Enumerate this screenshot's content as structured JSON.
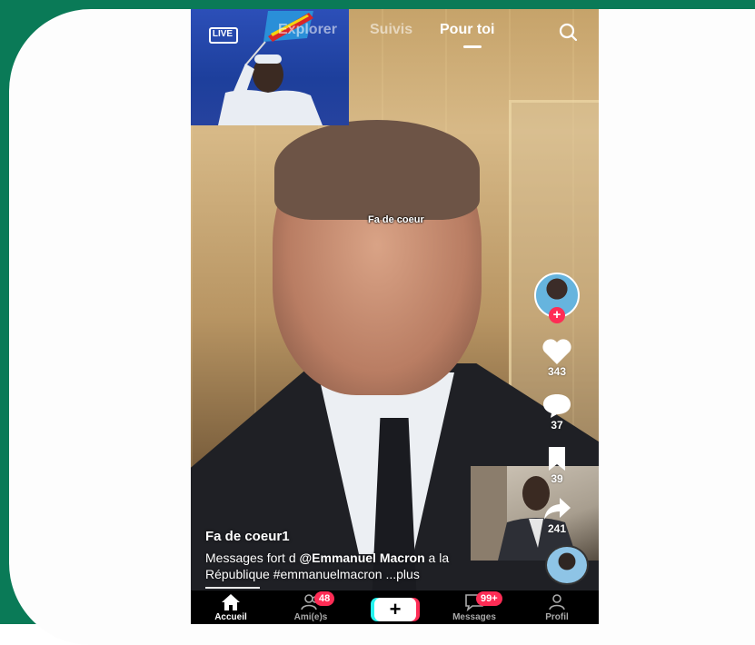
{
  "nav": {
    "live_label": "LIVE",
    "tabs": [
      {
        "label": "Explorer",
        "active": false
      },
      {
        "label": "Suivis",
        "active": false
      },
      {
        "label": "Pour toi",
        "active": true
      }
    ]
  },
  "video": {
    "overlay_text": "Fa de coeur",
    "author": "Fa de coeur1",
    "description_prefix": "Messages fort d ",
    "mention": "@Emmanuel Macron",
    "description_suffix": " a la République ",
    "hashtag": "#emmanuelmacron",
    "more": " ...plus"
  },
  "actions": {
    "likes": "343",
    "comments": "37",
    "saves": "39",
    "shares": "241",
    "follow_symbol": "+"
  },
  "bottom_bar": {
    "home": "Accueil",
    "friends": "Ami(e)s",
    "friends_badge": "48",
    "create": "+",
    "messages": "Messages",
    "messages_badge": "99+",
    "profile": "Profil"
  },
  "colors": {
    "frame_green": "#0a7a57",
    "accent_red": "#fe2c55",
    "accent_cyan": "#25f4ee"
  }
}
